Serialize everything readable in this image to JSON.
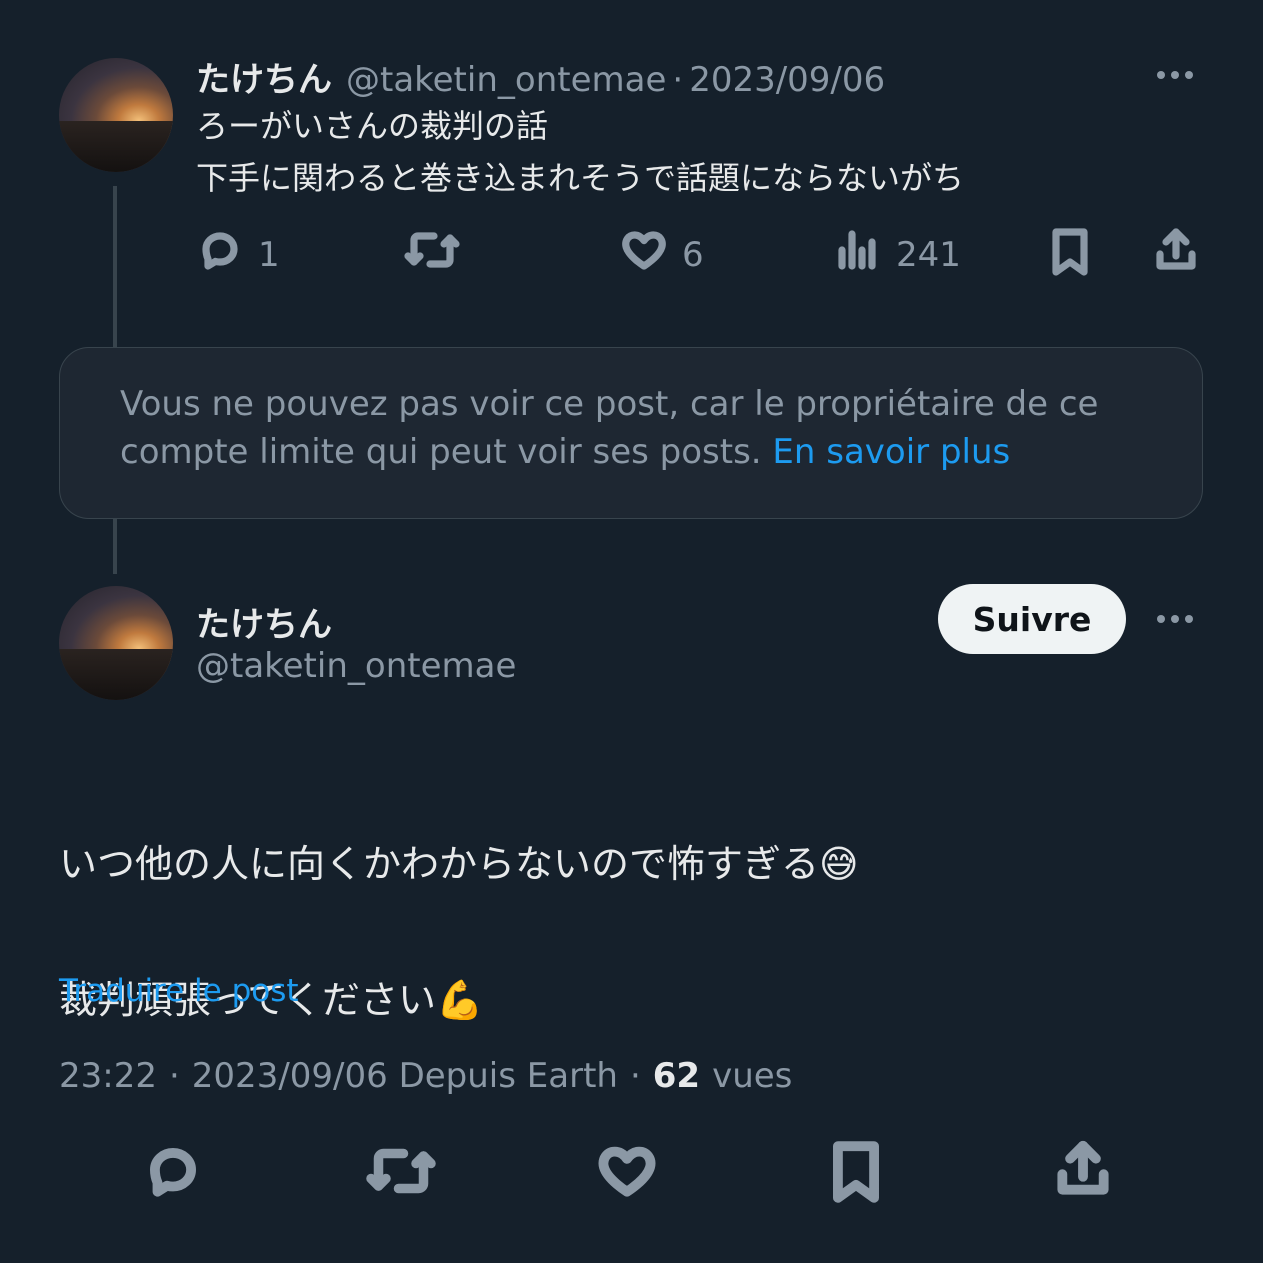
{
  "tweet1": {
    "display_name": "たけちん",
    "handle": "@taketin_ontemae",
    "separator": "·",
    "date": "2023/09/06",
    "text": "ろーがいさんの裁判の話\n下手に関わると巻き込まれそうで話題にならないがち",
    "actions": {
      "reply_icon": "reply-icon",
      "reply_count": "1",
      "retweet_icon": "retweet-icon",
      "like_icon": "heart-icon",
      "like_count": "6",
      "views_icon": "views-chart-icon",
      "views_count": "241",
      "bookmark_icon": "bookmark-icon",
      "share_icon": "share-icon"
    }
  },
  "restricted": {
    "message": "Vous ne pouvez pas voir ce post, car le propriétaire de ce compte limite qui peut voir ses posts.",
    "link": "En savoir plus"
  },
  "tweet2": {
    "display_name": "たけちん",
    "handle": "@taketin_ontemae",
    "follow_label": "Suivre",
    "line1": "いつ他の人に向くかわからないので怖すぎる",
    "line1_emoji": "😅",
    "line2": "裁判頑張ってください",
    "line2_emoji": "💪",
    "translate": "Traduire le post",
    "time": "23:22",
    "sep": "·",
    "date_source": "2023/09/06 Depuis Earth",
    "sep2": "·",
    "views": "62",
    "views_label": "vues"
  },
  "colors": {
    "background": "#15202b",
    "link": "#1d9bf0",
    "muted": "#8b98a5",
    "text": "#e7e9ea"
  }
}
